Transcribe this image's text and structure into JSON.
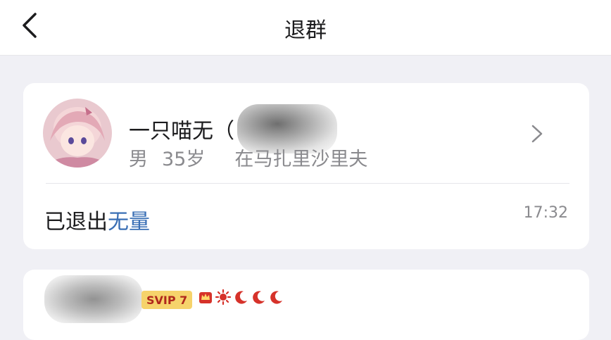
{
  "nav": {
    "title": "退群"
  },
  "member": {
    "name": "一只喵无（",
    "gender": "男",
    "age": "35岁",
    "location": "在马扎里沙里夫"
  },
  "event": {
    "action": "已退出",
    "group": "无量",
    "time": "17:32"
  },
  "next_member": {
    "vip_label": "SVIP 7"
  },
  "colors": {
    "link": "#3a6fb5",
    "vip_bg": "#f6d36b",
    "vip_text": "#b0281c",
    "moon": "#d6322a"
  }
}
